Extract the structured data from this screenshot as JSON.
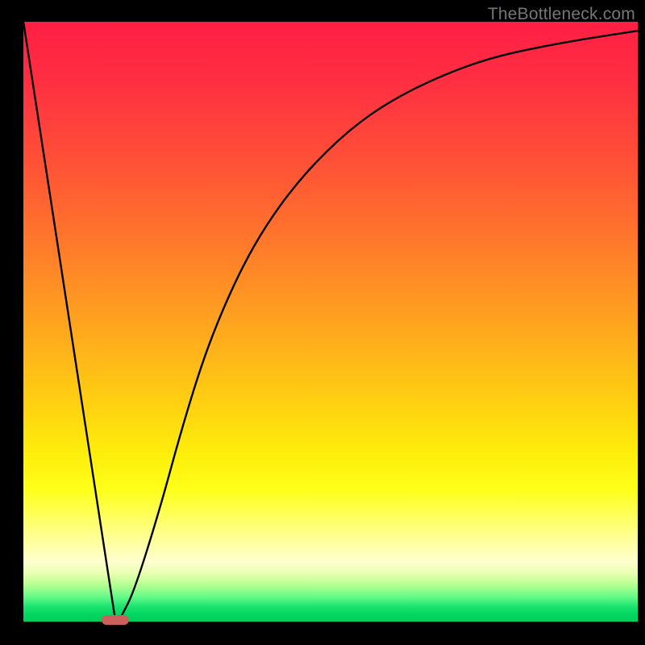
{
  "watermark": "TheBottleneck.com",
  "chart_data": {
    "type": "line",
    "title": "",
    "xlabel": "",
    "ylabel": "",
    "xlim": [
      0,
      100
    ],
    "ylim": [
      0,
      100
    ],
    "series": [
      {
        "name": "bottleneck-curve",
        "x": [
          0,
          14,
          15,
          16,
          18,
          22,
          26,
          30,
          35,
          40,
          46,
          53,
          60,
          68,
          76,
          85,
          93,
          100
        ],
        "y": [
          100,
          3,
          0,
          1,
          5,
          18,
          33,
          46,
          58,
          67,
          75,
          82,
          87,
          91,
          94,
          96,
          97.4,
          98.5
        ]
      }
    ],
    "marker": {
      "x_center": 15,
      "y": 0,
      "width": 4.5
    },
    "gradient_stops": [
      {
        "pos": 0,
        "color": "#ff1f44"
      },
      {
        "pos": 24,
        "color": "#ff5236"
      },
      {
        "pos": 50,
        "color": "#ffa31f"
      },
      {
        "pos": 72,
        "color": "#fdee0b"
      },
      {
        "pos": 90,
        "color": "#ffffcf"
      },
      {
        "pos": 100,
        "color": "#00cc59"
      }
    ]
  }
}
